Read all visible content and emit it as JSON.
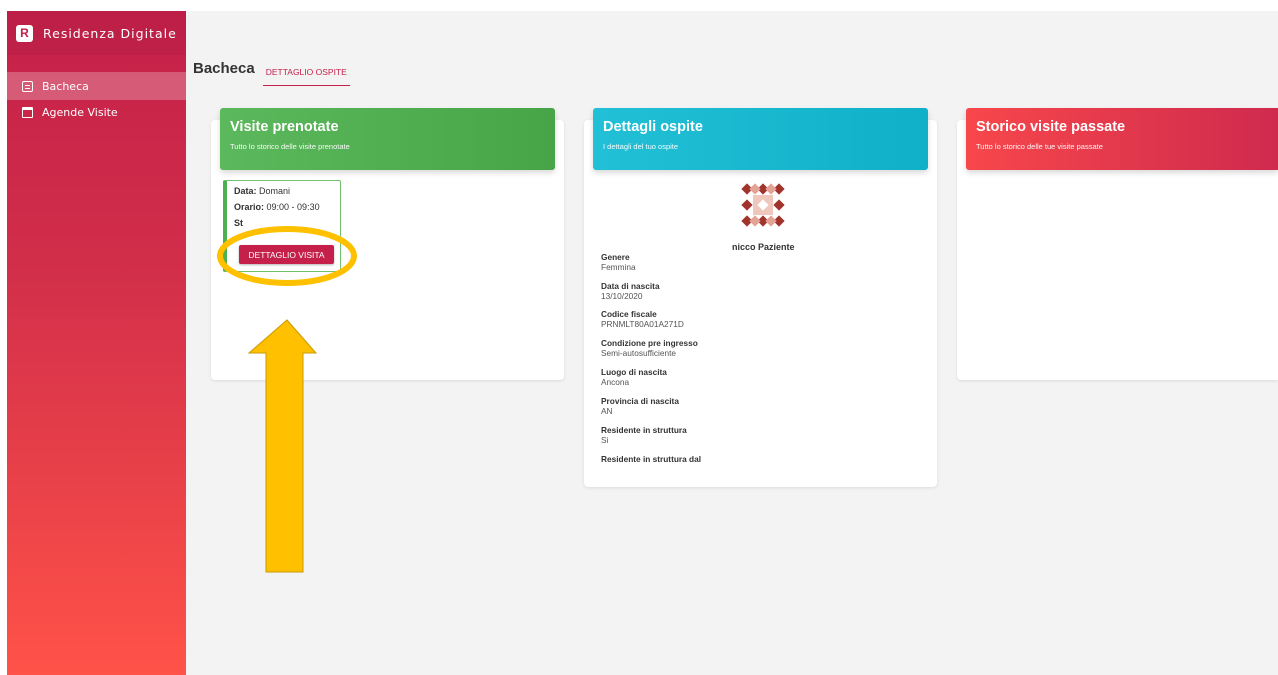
{
  "app": {
    "name": "Residenza Digitale",
    "logo_letter": "R"
  },
  "sidebar": {
    "items": [
      {
        "label": "Bacheca"
      },
      {
        "label": "Agende Visite"
      }
    ]
  },
  "breadcrumb": {
    "title": "Bacheca",
    "tab": "DETTAGLIO OSPITE"
  },
  "visite": {
    "title": "Visite prenotate",
    "subtitle": "Tutto lo storico delle visite prenotate",
    "visit": {
      "data_label": "Data:",
      "data_value": "Domani",
      "orario_label": "Orario:",
      "orario_value": "09:00 - 09:30",
      "stato_label": "St"
    },
    "button_label": "DETTAGLIO VISITA"
  },
  "ospite": {
    "title": "Dettagli ospite",
    "subtitle": "I dettagli del tuo ospite",
    "name": "nicco Paziente",
    "fields": [
      {
        "label": "Genere",
        "value": "Femmina"
      },
      {
        "label": "Data di nascita",
        "value": "13/10/2020"
      },
      {
        "label": "Codice fiscale",
        "value": "PRNMLT80A01A271D"
      },
      {
        "label": "Condizione pre ingresso",
        "value": "Semi-autosufficiente"
      },
      {
        "label": "Luogo di nascita",
        "value": "Ancona"
      },
      {
        "label": "Provincia di nascita",
        "value": "AN"
      },
      {
        "label": "Residente in struttura",
        "value": "Si"
      },
      {
        "label": "Residente in struttura dal",
        "value": ""
      }
    ]
  },
  "storico": {
    "title": "Storico visite passate",
    "subtitle": "Tutto lo storico delle tue visite passate"
  },
  "colors": {
    "primary": "#c4204a",
    "green": "#4caf50",
    "cyan": "#19b8d0",
    "red": "#f0434b",
    "highlight": "#ffc000"
  }
}
